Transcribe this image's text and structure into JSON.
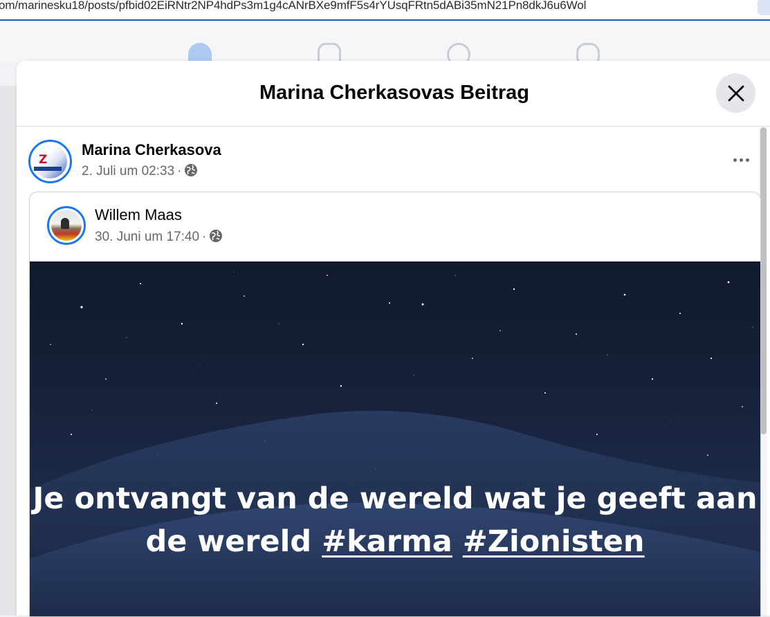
{
  "browser": {
    "url": "om/marinesku18/posts/pfbid02EiRNtr2NP4hdPs3m1g4cANrBXe9mfF5s4rYUsqFRtn5dABi35mN21Pn8dkJ6u6Wol"
  },
  "top_nav": {
    "icons": [
      "home-icon",
      "marketplace-icon",
      "groups-icon",
      "gaming-icon"
    ],
    "active": "home-icon",
    "active_color": "#1877f2"
  },
  "modal": {
    "title": "Marina Cherkasovas Beitrag"
  },
  "post": {
    "author": "Marina Cherkasova",
    "timestamp": "2. Juli um 02:33",
    "separator": "·",
    "privacy_icon": "globe-icon",
    "shared": {
      "author": "Willem Maas",
      "timestamp": "30. Juni um 17:40",
      "separator": "·",
      "privacy_icon": "globe-icon",
      "image_text": {
        "text": "Je ontvangt van de wereld wat je geeft aan de wereld",
        "hashtags": [
          "#karma",
          "#Zionisten"
        ]
      }
    }
  },
  "colors": {
    "accent": "#1877f2",
    "secondary_text": "#65676b",
    "image_background": "#16213a"
  }
}
